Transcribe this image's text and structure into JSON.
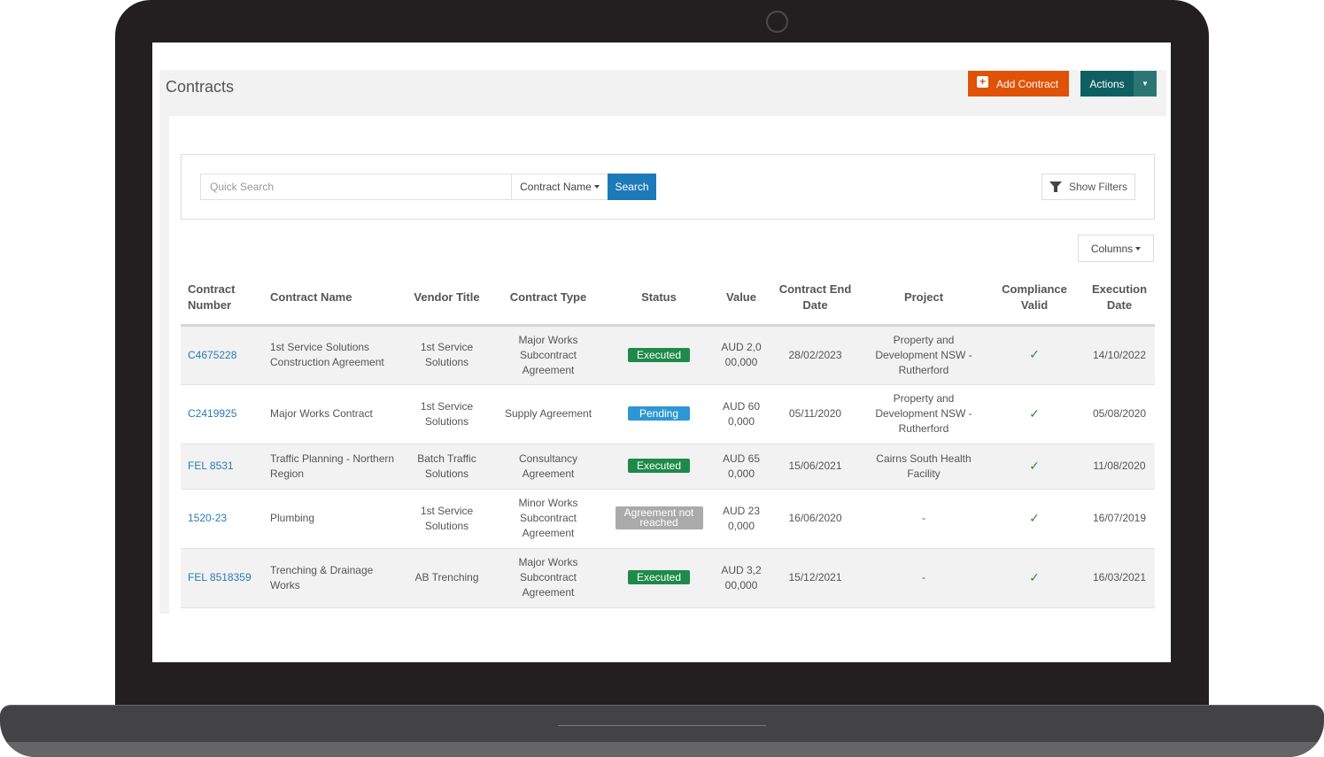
{
  "page": {
    "title": "Contracts",
    "add_contract_label": "Add Contract",
    "actions_label": "Actions"
  },
  "search": {
    "placeholder": "Quick Search",
    "field_selected": "Contract Name",
    "search_label": "Search",
    "show_filters_label": "Show Filters",
    "columns_label": "Columns"
  },
  "table": {
    "headers": {
      "contract_number": [
        "Contract",
        "Number"
      ],
      "contract_name": "Contract Name",
      "vendor_title": "Vendor Title",
      "contract_type": "Contract Type",
      "status": "Status",
      "value": "Value",
      "end_date": [
        "Contract End",
        "Date"
      ],
      "project": "Project",
      "compliance": [
        "Compliance",
        "Valid"
      ],
      "execution_date": [
        "Execution",
        "Date"
      ]
    },
    "rows": [
      {
        "number": "C4675228",
        "name": "1st Service Solutions Construction Agreement",
        "vendor": "1st Service Solutions",
        "type": "Major Works Subcontract Agreement",
        "status": "Executed",
        "value": "AUD 2,000,000",
        "end_date": "28/02/2023",
        "project": "Property and Development NSW - Rutherford",
        "compliance_valid": true,
        "execution_date": "14/10/2022"
      },
      {
        "number": "C2419925",
        "name": "Major Works Contract",
        "vendor": "1st Service Solutions",
        "type": "Supply Agreement",
        "status": "Pending",
        "value": "AUD 600,000",
        "end_date": "05/11/2020",
        "project": "Property and Development NSW - Rutherford",
        "compliance_valid": true,
        "execution_date": "05/08/2020"
      },
      {
        "number": "FEL 8531",
        "name": "Traffic Planning - Northern Region",
        "vendor": "Batch Traffic Solutions",
        "type": "Consultancy Agreement",
        "status": "Executed",
        "value": "AUD 650,000",
        "end_date": "15/06/2021",
        "project": "Cairns South Health Facility",
        "compliance_valid": true,
        "execution_date": "11/08/2020"
      },
      {
        "number": "1520-23",
        "name": "Plumbing",
        "vendor": "1st Service Solutions",
        "type": "Minor Works Subcontract Agreement",
        "status": "Agreement not reached",
        "value": "AUD 230,000",
        "end_date": "16/06/2020",
        "project": "-",
        "compliance_valid": true,
        "execution_date": "16/07/2019"
      },
      {
        "number": "FEL 8518359",
        "name": "Trenching & Drainage Works",
        "vendor": "AB Trenching",
        "type": "Major Works Subcontract Agreement",
        "status": "Executed",
        "value": "AUD 3,200,000",
        "end_date": "15/12/2021",
        "project": "-",
        "compliance_valid": true,
        "execution_date": "16/03/2021"
      }
    ]
  },
  "icons": {
    "add": "plus-square-icon",
    "actions_caret": "caret-down-icon",
    "filters": "funnel-icon",
    "compliance": "checkmark-icon",
    "check_glyph": "✓"
  },
  "colors": {
    "add_button": "#e05206",
    "actions_button": "#0e5f61",
    "search_button": "#1d7ab8",
    "executed": "#1e8a4a",
    "pending": "#2d97d3",
    "not_reached": "#aaaaaa",
    "link": "#2a7ab8"
  }
}
